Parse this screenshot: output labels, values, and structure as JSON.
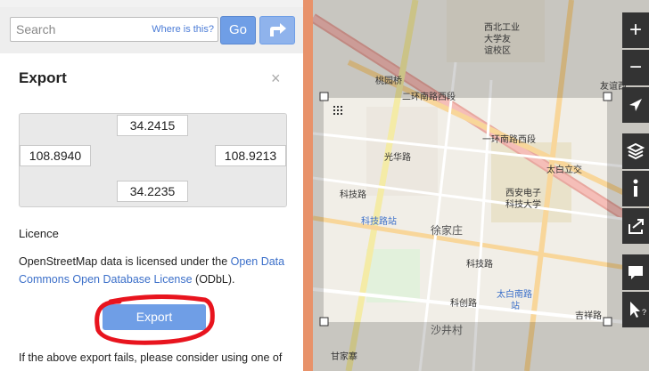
{
  "search": {
    "placeholder": "Search",
    "where_link": "Where is this?",
    "go_label": "Go"
  },
  "export_panel": {
    "title": "Export",
    "close_symbol": "×"
  },
  "bbox": {
    "north": "34.2415",
    "west": "108.8940",
    "east": "108.9213",
    "south": "34.2235"
  },
  "licence": {
    "heading": "Licence",
    "text_before": "OpenStreetMap data is licensed under the ",
    "link_text": "Open Data Commons Open Database License",
    "text_after": " (ODbL)."
  },
  "export_button": {
    "label": "Export"
  },
  "footer_text": "If the above export fails, please consider using one of",
  "map_labels": {
    "l1": "西北工业",
    "l2": "大学友",
    "l3": "谊校区",
    "l4": "桃园桥",
    "l5": "二环南路西段",
    "l6": "一环南路西段",
    "l7": "太白立交",
    "l8": "西安电子",
    "l9": "科技大学",
    "l10": "光华路",
    "l11": "科技路站",
    "l12": "徐家庄",
    "l13": "科技路",
    "l14": "太白南路",
    "l15": "站",
    "l16": "沙井村",
    "l17": "甘家寨",
    "l18": "友谊西",
    "l19": "科技路",
    "l20": "科创路",
    "l21": "吉祥路"
  },
  "map_controls": {
    "zoom_in": "+",
    "zoom_out": "−",
    "query": "?"
  },
  "colors": {
    "accent": "#6f9ee6",
    "divider": "#e8926a",
    "annotation_ring": "#e8141e"
  }
}
